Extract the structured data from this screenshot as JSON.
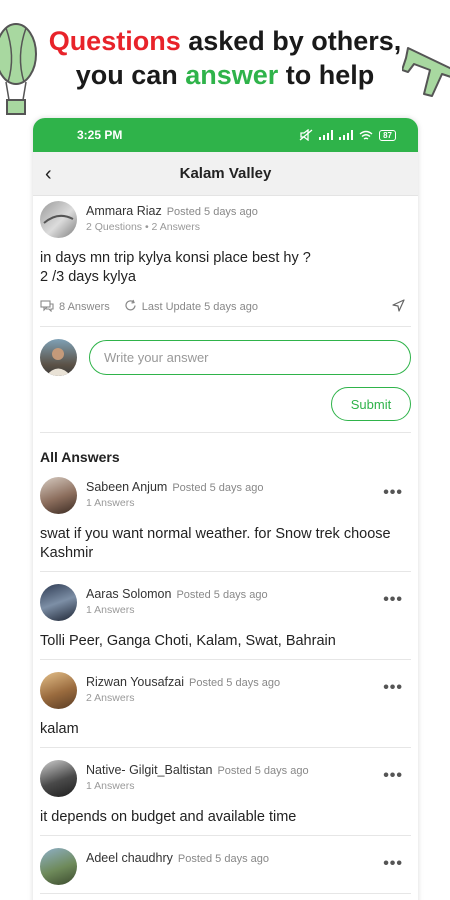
{
  "promo": {
    "part1": "Questions",
    "part2": " asked by others,",
    "part3": "you can ",
    "part4": "answer",
    "part5": " to help"
  },
  "status": {
    "time": "3:25 PM",
    "battery": "87"
  },
  "appbar": {
    "title": "Kalam Valley"
  },
  "question": {
    "author": "Ammara Riaz",
    "posted": "Posted 5 days ago",
    "sub": "2 Questions • 2 Answers",
    "text": "in days mn trip kylya konsi place best hy ?\n2 /3 days kylya",
    "answers_count": "8 Answers",
    "last_update": "Last Update 5 days ago"
  },
  "answer_input": {
    "placeholder": "Write your answer"
  },
  "submit_label": "Submit",
  "all_answers_label": "All Answers",
  "answers": [
    {
      "name": "Sabeen Anjum",
      "posted": "Posted 5 days ago",
      "sub": "1 Answers",
      "text": "swat if you want normal weather. for Snow trek choose  Kashmir"
    },
    {
      "name": "Aaras Solomon",
      "posted": "Posted 5 days ago",
      "sub": "1 Answers",
      "text": "Tolli Peer, Ganga Choti, Kalam, Swat, Bahrain"
    },
    {
      "name": "Rizwan Yousafzai",
      "posted": "Posted 5 days ago",
      "sub": "2 Answers",
      "text": "kalam"
    },
    {
      "name": "Native- Gilgit_Baltistan",
      "posted": "Posted 5 days ago",
      "sub": "1 Answers",
      "text": "it depends on budget and available time"
    },
    {
      "name": "Adeel chaudhry",
      "posted": "Posted 5 days ago",
      "sub": "",
      "text": ""
    }
  ],
  "colors": {
    "brand_green": "#2fb34a",
    "accent_red": "#e8232a"
  },
  "icons": [
    "back-arrow-icon",
    "comments-icon",
    "refresh-icon",
    "send-icon",
    "more-dots-icon",
    "balloon-icon",
    "airplane-icon"
  ]
}
